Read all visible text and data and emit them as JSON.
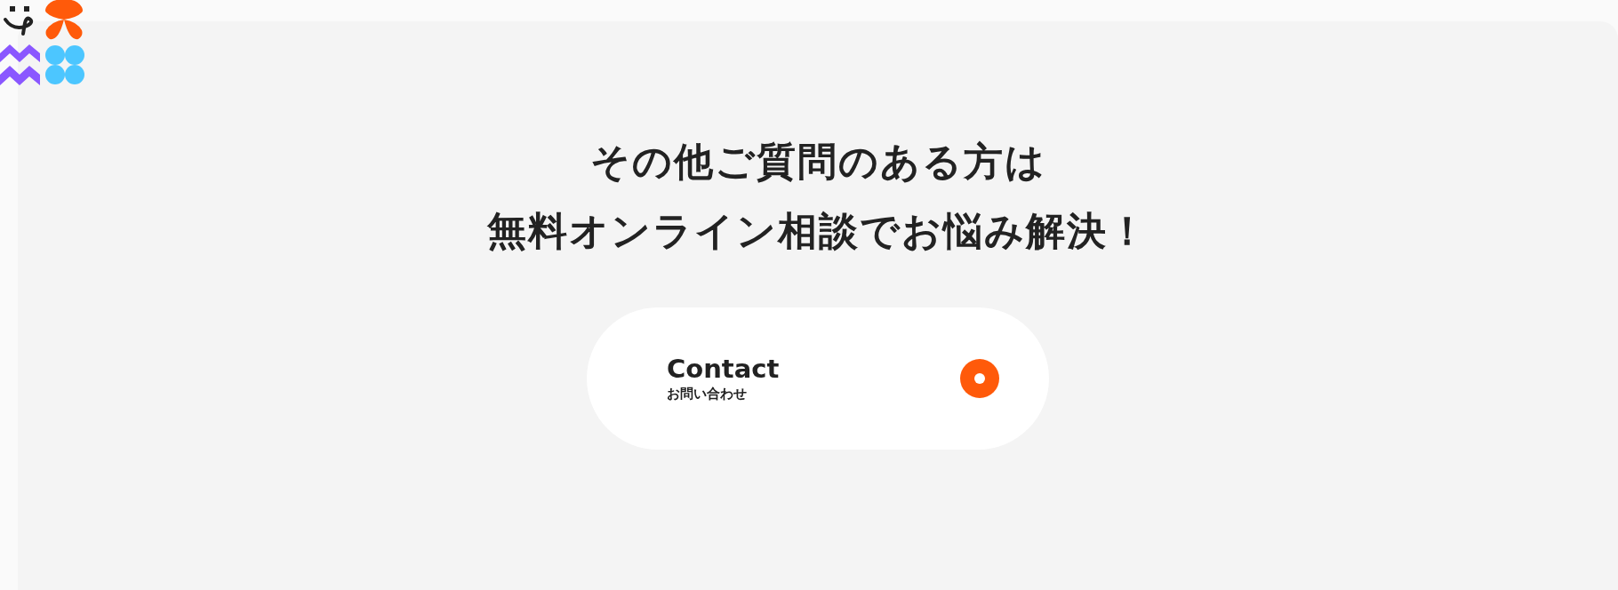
{
  "heading": [
    "その他ご質問のある方は",
    "無料オンライン相談でお悩み解決！"
  ],
  "contact_button": {
    "label": "Contact",
    "sublabel": "お問い合わせ"
  }
}
